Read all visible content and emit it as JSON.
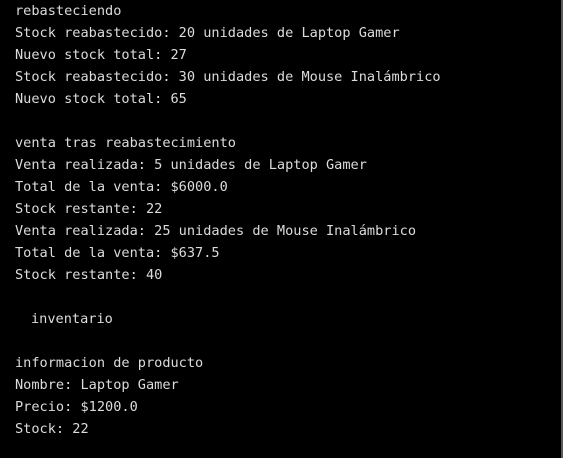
{
  "console": {
    "lines": [
      {
        "text": "rebasteciendo"
      },
      {
        "text": "Stock reabastecido: 20 unidades de Laptop Gamer"
      },
      {
        "text": "Nuevo stock total: 27"
      },
      {
        "text": "Stock reabastecido: 30 unidades de Mouse Inalámbrico"
      },
      {
        "text": "Nuevo stock total: 65"
      },
      {
        "text": ""
      },
      {
        "text": "venta tras reabastecimiento"
      },
      {
        "text": "Venta realizada: 5 unidades de Laptop Gamer"
      },
      {
        "text": "Total de la venta: $6000.0"
      },
      {
        "text": "Stock restante: 22"
      },
      {
        "text": "Venta realizada: 25 unidades de Mouse Inalámbrico"
      },
      {
        "text": "Total de la venta: $637.5"
      },
      {
        "text": "Stock restante: 40"
      },
      {
        "text": ""
      },
      {
        "text": "inventario"
      },
      {
        "text": ""
      },
      {
        "text": "informacion de producto"
      },
      {
        "text": "Nombre: Laptop Gamer"
      },
      {
        "text": "Precio: $1200.0"
      },
      {
        "text": "Stock: 22"
      }
    ],
    "colors": {
      "background": "#000000",
      "text": "#dcdcdc"
    }
  }
}
